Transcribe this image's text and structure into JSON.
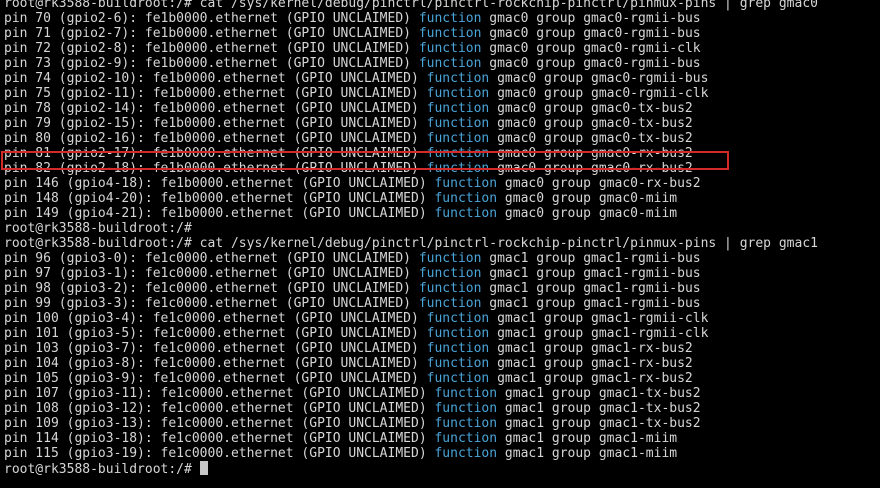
{
  "terminal": {
    "prompt": "root@rk3588-buildroot:/# ",
    "keyword": "function",
    "highlighted_line_index": 10,
    "lines": [
      {
        "text": "root@rk3588-buildroot:/# cat /sys/kernel/debug/pinctrl/pinctrl-rockchip-pinctrl/pinmux-pins | grep gmac0"
      },
      {
        "pre": "pin 70 (gpio2-6): fe1b0000.ethernet (GPIO UNCLAIMED) ",
        "kw": "function",
        "post": " gmac0 group gmac0-rgmii-bus"
      },
      {
        "pre": "pin 71 (gpio2-7): fe1b0000.ethernet (GPIO UNCLAIMED) ",
        "kw": "function",
        "post": " gmac0 group gmac0-rgmii-bus"
      },
      {
        "pre": "pin 72 (gpio2-8): fe1b0000.ethernet (GPIO UNCLAIMED) ",
        "kw": "function",
        "post": " gmac0 group gmac0-rgmii-clk"
      },
      {
        "pre": "pin 73 (gpio2-9): fe1b0000.ethernet (GPIO UNCLAIMED) ",
        "kw": "function",
        "post": " gmac0 group gmac0-rgmii-bus"
      },
      {
        "pre": "pin 74 (gpio2-10): fe1b0000.ethernet (GPIO UNCLAIMED) ",
        "kw": "function",
        "post": " gmac0 group gmac0-rgmii-bus"
      },
      {
        "pre": "pin 75 (gpio2-11): fe1b0000.ethernet (GPIO UNCLAIMED) ",
        "kw": "function",
        "post": " gmac0 group gmac0-rgmii-clk"
      },
      {
        "pre": "pin 78 (gpio2-14): fe1b0000.ethernet (GPIO UNCLAIMED) ",
        "kw": "function",
        "post": " gmac0 group gmac0-tx-bus2"
      },
      {
        "pre": "pin 79 (gpio2-15): fe1b0000.ethernet (GPIO UNCLAIMED) ",
        "kw": "function",
        "post": " gmac0 group gmac0-tx-bus2"
      },
      {
        "pre": "pin 80 (gpio2-16): fe1b0000.ethernet (GPIO UNCLAIMED) ",
        "kw": "function",
        "post": " gmac0 group gmac0-tx-bus2"
      },
      {
        "pre": "pin 81 (gpio2-17): fe1b0000.ethernet (GPIO UNCLAIMED) ",
        "kw": "function",
        "post": " gmac0 group gmac0-rx-bus2"
      },
      {
        "pre": "pin 82 (gpio2-18): fe1b0000.ethernet (GPIO UNCLAIMED) ",
        "kw": "function",
        "post": " gmac0 group gmac0-rx-bus2"
      },
      {
        "pre": "pin 146 (gpio4-18): fe1b0000.ethernet (GPIO UNCLAIMED) ",
        "kw": "function",
        "post": " gmac0 group gmac0-rx-bus2"
      },
      {
        "pre": "pin 148 (gpio4-20): fe1b0000.ethernet (GPIO UNCLAIMED) ",
        "kw": "function",
        "post": " gmac0 group gmac0-miim"
      },
      {
        "pre": "pin 149 (gpio4-21): fe1b0000.ethernet (GPIO UNCLAIMED) ",
        "kw": "function",
        "post": " gmac0 group gmac0-miim"
      },
      {
        "text": "root@rk3588-buildroot:/#"
      },
      {
        "text": "root@rk3588-buildroot:/# cat /sys/kernel/debug/pinctrl/pinctrl-rockchip-pinctrl/pinmux-pins | grep gmac1"
      },
      {
        "pre": "pin 96 (gpio3-0): fe1c0000.ethernet (GPIO UNCLAIMED) ",
        "kw": "function",
        "post": " gmac1 group gmac1-rgmii-bus"
      },
      {
        "pre": "pin 97 (gpio3-1): fe1c0000.ethernet (GPIO UNCLAIMED) ",
        "kw": "function",
        "post": " gmac1 group gmac1-rgmii-bus"
      },
      {
        "pre": "pin 98 (gpio3-2): fe1c0000.ethernet (GPIO UNCLAIMED) ",
        "kw": "function",
        "post": " gmac1 group gmac1-rgmii-bus"
      },
      {
        "pre": "pin 99 (gpio3-3): fe1c0000.ethernet (GPIO UNCLAIMED) ",
        "kw": "function",
        "post": " gmac1 group gmac1-rgmii-bus"
      },
      {
        "pre": "pin 100 (gpio3-4): fe1c0000.ethernet (GPIO UNCLAIMED) ",
        "kw": "function",
        "post": " gmac1 group gmac1-rgmii-clk"
      },
      {
        "pre": "pin 101 (gpio3-5): fe1c0000.ethernet (GPIO UNCLAIMED) ",
        "kw": "function",
        "post": " gmac1 group gmac1-rgmii-clk"
      },
      {
        "pre": "pin 103 (gpio3-7): fe1c0000.ethernet (GPIO UNCLAIMED) ",
        "kw": "function",
        "post": " gmac1 group gmac1-rx-bus2"
      },
      {
        "pre": "pin 104 (gpio3-8): fe1c0000.ethernet (GPIO UNCLAIMED) ",
        "kw": "function",
        "post": " gmac1 group gmac1-rx-bus2"
      },
      {
        "pre": "pin 105 (gpio3-9): fe1c0000.ethernet (GPIO UNCLAIMED) ",
        "kw": "function",
        "post": " gmac1 group gmac1-rx-bus2"
      },
      {
        "pre": "pin 107 (gpio3-11): fe1c0000.ethernet (GPIO UNCLAIMED) ",
        "kw": "function",
        "post": " gmac1 group gmac1-tx-bus2"
      },
      {
        "pre": "pin 108 (gpio3-12): fe1c0000.ethernet (GPIO UNCLAIMED) ",
        "kw": "function",
        "post": " gmac1 group gmac1-tx-bus2"
      },
      {
        "pre": "pin 109 (gpio3-13): fe1c0000.ethernet (GPIO UNCLAIMED) ",
        "kw": "function",
        "post": " gmac1 group gmac1-tx-bus2"
      },
      {
        "pre": "pin 114 (gpio3-18): fe1c0000.ethernet (GPIO UNCLAIMED) ",
        "kw": "function",
        "post": " gmac1 group gmac1-miim"
      },
      {
        "pre": "pin 115 (gpio3-19): fe1c0000.ethernet (GPIO UNCLAIMED) ",
        "kw": "function",
        "post": " gmac1 group gmac1-miim"
      }
    ]
  },
  "colors": {
    "background": "#000000",
    "text": "#d6d6d6",
    "keyword": "#49a4d8",
    "highlight_border": "#d52a2a",
    "cursor": "#c8c8c8"
  }
}
